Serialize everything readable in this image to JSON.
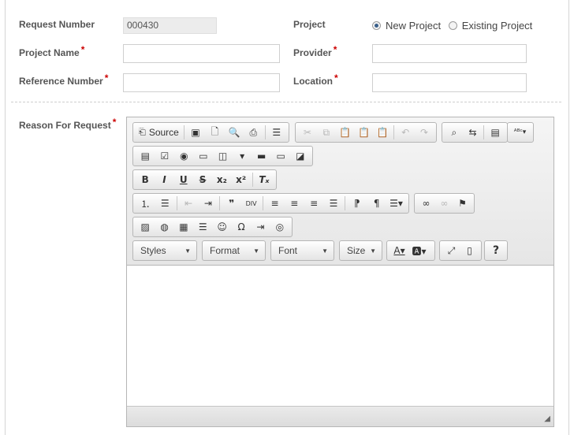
{
  "form": {
    "request_number_label": "Request Number",
    "request_number_value": "000430",
    "project_label": "Project",
    "project_options": [
      "New Project",
      "Existing Project"
    ],
    "project_selected": "New Project",
    "project_name_label": "Project Name",
    "provider_label": "Provider",
    "reference_number_label": "Reference Number",
    "location_label": "Location",
    "reason_label": "Reason For Request",
    "required_mark": "*"
  },
  "editor": {
    "source_label": "Source",
    "combos": [
      "Styles",
      "Format",
      "Font",
      "Size"
    ],
    "toolbar_icons": {
      "row1": [
        "source",
        "save",
        "new-page",
        "preview",
        "print",
        "templates",
        "cut",
        "copy",
        "paste",
        "paste-text",
        "paste-word",
        "undo",
        "redo",
        "find",
        "replace",
        "select-all",
        "spellcheck"
      ],
      "row2": [
        "form",
        "checkbox",
        "radio",
        "textfield",
        "textarea",
        "select",
        "button",
        "image-button",
        "hidden-field"
      ],
      "row3": [
        "bold",
        "italic",
        "underline",
        "strike",
        "subscript",
        "superscript",
        "remove-format"
      ],
      "row4": [
        "numbered-list",
        "bulleted-list",
        "outdent",
        "indent",
        "blockquote",
        "div",
        "align-left",
        "align-center",
        "align-right",
        "justify",
        "ltr",
        "rtl",
        "language",
        "link",
        "unlink",
        "anchor"
      ],
      "row5": [
        "image",
        "flash",
        "table",
        "horizontal-rule",
        "smiley",
        "special-char",
        "page-break",
        "iframe"
      ],
      "row6": [
        "text-color",
        "bg-color",
        "maximize",
        "show-blocks",
        "about"
      ]
    },
    "content": ""
  }
}
